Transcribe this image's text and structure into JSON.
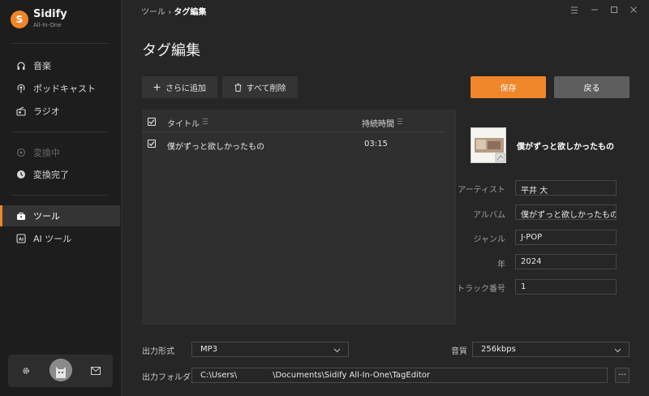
{
  "app": {
    "name": "Sidify",
    "subtitle": "All-In-One",
    "logo_letter": "S",
    "accent": "#f0862a"
  },
  "sidebar": {
    "items": [
      {
        "label": "音楽",
        "icon": "headphones-icon",
        "state": "normal"
      },
      {
        "label": "ポッドキャスト",
        "icon": "podcast-icon",
        "state": "normal"
      },
      {
        "label": "ラジオ",
        "icon": "radio-icon",
        "state": "normal"
      },
      {
        "label": "変換中",
        "icon": "converting-icon",
        "state": "disabled"
      },
      {
        "label": "変換完了",
        "icon": "clock-icon",
        "state": "normal"
      },
      {
        "label": "ツール",
        "icon": "toolbox-icon",
        "state": "active"
      },
      {
        "label": "AI ツール",
        "icon": "ai-icon",
        "state": "normal"
      }
    ],
    "footer": {
      "settings_icon": "gear-icon",
      "avatar": "avatar",
      "mail_icon": "mail-icon"
    }
  },
  "titlebar": {
    "breadcrumb_parent": "ツール",
    "breadcrumb_sep": "›",
    "breadcrumb_current": "タグ編集",
    "buttons": [
      "menu-icon",
      "minimize-icon",
      "maximize-icon",
      "close-icon"
    ]
  },
  "page": {
    "title": "タグ編集"
  },
  "toolbar": {
    "add_label": "さらに追加",
    "delete_all_label": "すべて削除",
    "save_label": "保存",
    "back_label": "戻る"
  },
  "list": {
    "columns": {
      "title": "タイトル",
      "duration": "持続時間"
    },
    "all_checked": true,
    "rows": [
      {
        "checked": true,
        "title": "僕がずっと欲しかったもの",
        "duration": "03:15"
      }
    ]
  },
  "detail": {
    "song_title": "僕がずっと欲しかったもの",
    "fields": [
      {
        "label": "アーティスト",
        "value": "平井 大"
      },
      {
        "label": "アルバム",
        "value": "僕がずっと欲しかったもの"
      },
      {
        "label": "ジャンル",
        "value": "J-POP"
      },
      {
        "label": "年",
        "value": "2024"
      },
      {
        "label": "トラック番号",
        "value": "1"
      }
    ]
  },
  "output": {
    "format_label": "出力形式",
    "format_value": "MP3",
    "quality_label": "音質",
    "quality_value": "256kbps",
    "folder_label": "出力フォルダ",
    "folder_prefix": "C:\\Users\\",
    "folder_suffix": "\\Documents\\Sidify All-In-One\\TagEditor",
    "browse_label": "···"
  }
}
